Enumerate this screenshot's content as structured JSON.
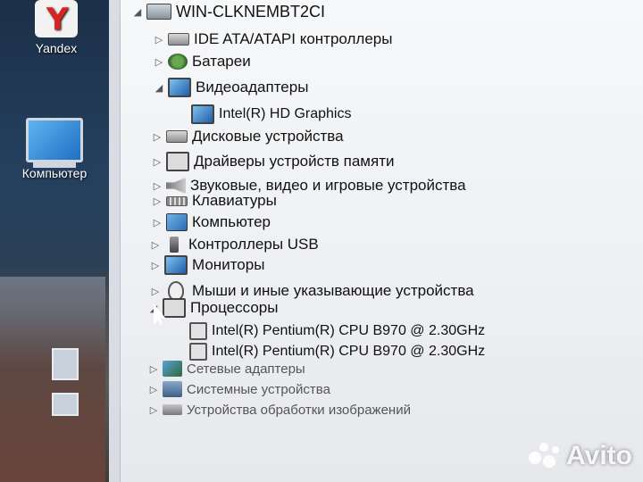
{
  "desktop": {
    "icons": [
      {
        "label": "Yandex",
        "icon": "yandex-icon"
      },
      {
        "label": "Компьютер",
        "icon": "computer-icon"
      }
    ]
  },
  "tree": {
    "host": "WIN-CLKNEMBT2CI",
    "categories": [
      {
        "label": "IDE ATA/ATAPI контроллеры",
        "icon": "ide-controller-icon",
        "expanded": false
      },
      {
        "label": "Батареи",
        "icon": "battery-icon",
        "expanded": false
      },
      {
        "label": "Видеоадаптеры",
        "icon": "display-adapter-icon",
        "expanded": true,
        "children": [
          "Intel(R) HD Graphics"
        ]
      },
      {
        "label": "Дисковые устройства",
        "icon": "disk-drive-icon",
        "expanded": false
      },
      {
        "label": "Драйверы устройств памяти",
        "icon": "memory-driver-icon",
        "expanded": false
      },
      {
        "label": "Звуковые, видео и игровые устройства",
        "icon": "sound-icon",
        "expanded": false
      },
      {
        "label": "Клавиатуры",
        "icon": "keyboard-icon",
        "expanded": false
      },
      {
        "label": "Компьютер",
        "icon": "computer-icon",
        "expanded": false
      },
      {
        "label": "Контроллеры USB",
        "icon": "usb-icon",
        "expanded": false
      },
      {
        "label": "Мониторы",
        "icon": "monitor-icon",
        "expanded": false
      },
      {
        "label": "Мыши и иные указывающие устройства",
        "icon": "mouse-icon",
        "expanded": false
      },
      {
        "label": "Процессоры",
        "icon": "processor-icon",
        "expanded": true,
        "children": [
          "Intel(R) Pentium(R) CPU B970 @ 2.30GHz",
          "Intel(R) Pentium(R) CPU B970 @ 2.30GHz"
        ]
      },
      {
        "label": "Сетевые адаптеры",
        "icon": "network-adapter-icon",
        "expanded": false
      },
      {
        "label": "Системные устройства",
        "icon": "system-devices-icon",
        "expanded": false
      },
      {
        "label": "Устройства обработки изображений",
        "icon": "imaging-devices-icon",
        "expanded": false
      }
    ]
  },
  "watermark": "Avito"
}
